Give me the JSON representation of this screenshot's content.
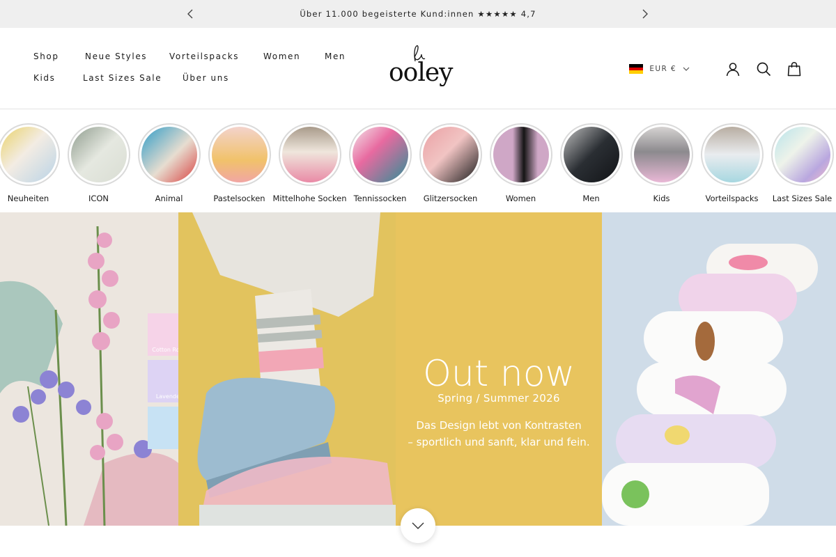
{
  "announcement": {
    "text": "Über 11.000 begeisterte Kund:innen ★★★★★ 4,7",
    "prev_icon": "chevron-left-icon",
    "next_icon": "chevron-right-icon"
  },
  "nav": {
    "items": [
      {
        "label": "Shop"
      },
      {
        "label": "Neue Styles"
      },
      {
        "label": "Vorteilspacks"
      },
      {
        "label": "Women"
      },
      {
        "label": "Men"
      },
      {
        "label": "Kids"
      },
      {
        "label": "Last Sizes Sale"
      },
      {
        "label": "Über uns"
      }
    ]
  },
  "logo": {
    "text": "ooley"
  },
  "utils": {
    "currency": "EUR €",
    "flag_colors": [
      "#000000",
      "#dd0000",
      "#ffce00"
    ],
    "icons": [
      "account-icon",
      "search-icon",
      "bag-icon"
    ]
  },
  "categories": [
    {
      "label": "Neuheiten",
      "color_a": "#b9d3e6",
      "color_b": "#e9d26a"
    },
    {
      "label": "ICON",
      "color_a": "#d9ddd3",
      "color_b": "#8f9c8e"
    },
    {
      "label": "Animal",
      "color_a": "#2f9cc7",
      "color_b": "#e7ddd0"
    },
    {
      "label": "Pastelsocken",
      "color_a": "#f3d3cc",
      "color_b": "#f1c26a"
    },
    {
      "label": "Mittelhohe Socken",
      "color_a": "#efe6dc",
      "color_b": "#e98aa6"
    },
    {
      "label": "Tennissocken",
      "color_a": "#2d8f97",
      "color_b": "#f2e7ea"
    },
    {
      "label": "Glitzersocken",
      "color_a": "#eaa0a4",
      "color_b": "#1c1c1c"
    },
    {
      "label": "Women",
      "color_a": "#cfa7c6",
      "color_b": "#141414"
    },
    {
      "label": "Men",
      "color_a": "#2a2e33",
      "color_b": "#bfbfbf"
    },
    {
      "label": "Kids",
      "color_a": "#d6d3d2",
      "color_b": "#8c8a8e"
    },
    {
      "label": "Vorteilspacks",
      "color_a": "#b8ada1",
      "color_b": "#e9ecef"
    },
    {
      "label": "Last Sizes Sale",
      "color_a": "#eef3ea",
      "color_b": "#b9a7df"
    }
  ],
  "hero": {
    "title": "Out now",
    "subtitle": "Spring / Summer 2026",
    "description_line1": "Das Design lebt von Kontrasten",
    "description_line2": "– sportlich und sanft, klar und fein.",
    "swatches": [
      {
        "label": "Cotton Rose",
        "color": "#f6d3e8"
      },
      {
        "label": "Lavender",
        "color": "#ddd3f4"
      },
      {
        "label": "",
        "color": "#c7e2f4"
      }
    ]
  },
  "scroll_icon": "chevron-down-icon"
}
